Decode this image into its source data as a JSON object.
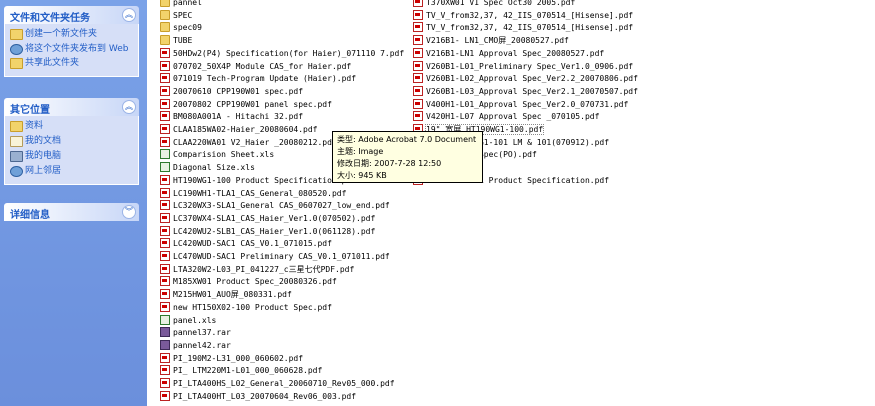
{
  "taskpane": {
    "tasks_title": "文件和文件夹任务",
    "tasks": [
      "创建一个新文件夹",
      "将这个文件夹发布到 Web",
      "共享此文件夹"
    ],
    "places_title": "其它位置",
    "places": [
      "资料",
      "我的文档",
      "我的电脑",
      "网上邻居"
    ],
    "details_title": "详细信息"
  },
  "col1": [
    {
      "name": "pannel",
      "type": "folder"
    },
    {
      "name": "SPEC",
      "type": "folder"
    },
    {
      "name": "spec09",
      "type": "folder"
    },
    {
      "name": "TUBE",
      "type": "folder"
    },
    {
      "name": "50HDw2(P4) Specification(for Haier)_071110 7.pdf",
      "type": "pdf"
    },
    {
      "name": "070702_50X4P Module CAS_for Haier.pdf",
      "type": "pdf"
    },
    {
      "name": "071019 Tech-Program Update (Haier).pdf",
      "type": "pdf"
    },
    {
      "name": "20070610 CPP190W01 spec.pdf",
      "type": "pdf"
    },
    {
      "name": "20070802 CPP190W01 panel spec.pdf",
      "type": "pdf"
    },
    {
      "name": "BM080A001A - Hitachi 32.pdf",
      "type": "pdf"
    },
    {
      "name": "CLAA185WA02-Haier_20080604.pdf",
      "type": "pdf"
    },
    {
      "name": "CLAA220WA01 V2_Haier _20080212.pdf",
      "type": "pdf"
    },
    {
      "name": "Comparision Sheet.xls",
      "type": "xls"
    },
    {
      "name": "Diagonal Size.xls",
      "type": "xls"
    },
    {
      "name": "HT190WG1-100 Product Specification.pdf",
      "type": "pdf"
    },
    {
      "name": "LC190WH1-TLA1_CAS_General_080520.pdf",
      "type": "pdf"
    },
    {
      "name": "LC320WX3-SLA1_General CAS_0607027_low_end.pdf",
      "type": "pdf"
    },
    {
      "name": "LC370WX4-SLA1_CAS_Haier_Ver1.0(070502).pdf",
      "type": "pdf"
    },
    {
      "name": "LC420WU2-SLB1_CAS_Haier_Ver1.0(061128).pdf",
      "type": "pdf"
    },
    {
      "name": "LC420WUD-SAC1 CAS_V0.1_071015.pdf",
      "type": "pdf"
    },
    {
      "name": "LC470WUD-SAC1 Preliminary CAS_V0.1_071011.pdf",
      "type": "pdf"
    },
    {
      "name": "LTA320W2-L03_PI_041227_c三星七代PDF.pdf",
      "type": "pdf"
    },
    {
      "name": "M185XW01 Product Spec_20080326.pdf",
      "type": "pdf"
    },
    {
      "name": "M215HW01_AUO屏_080331.pdf",
      "type": "pdf"
    },
    {
      "name": "new  HT150X02-100 Product Spec.pdf",
      "type": "pdf"
    },
    {
      "name": "panel.xls",
      "type": "xls"
    },
    {
      "name": "pannel37.rar",
      "type": "rar"
    },
    {
      "name": "pannel42.rar",
      "type": "rar"
    },
    {
      "name": "PI_190M2-L31_000_060602.pdf",
      "type": "pdf"
    },
    {
      "name": "PI_ LTM220M1-L01_000_060628.pdf",
      "type": "pdf"
    },
    {
      "name": "PI_LTA400HS_L02_General_20060710_Rev05_000.pdf",
      "type": "pdf"
    },
    {
      "name": "PI_LTA400HT_L03_20070604_Rev06_003.pdf",
      "type": "pdf"
    }
  ],
  "col2": [
    {
      "name": "T370XW01 V1 Spec Oct30 2005.pdf",
      "type": "pdf"
    },
    {
      "name": "TV_V_from32,37, 42_IIS_070514_[Hisense].pdf",
      "type": "pdf"
    },
    {
      "name": "TV_V_from32,37, 42_IIS_070514_[Hisense].pdf",
      "type": "pdf"
    },
    {
      "name": "V216B1- LN1_CMO屏_20080527.pdf",
      "type": "pdf"
    },
    {
      "name": "V216B1-LN1 Approval Spec_20080527.pdf",
      "type": "pdf"
    },
    {
      "name": "V260B1-L01_Preliminary  Spec_Ver1.0_0906.pdf",
      "type": "pdf"
    },
    {
      "name": "V260B1-L02_Approval Spec_Ver2.2_20070806.pdf",
      "type": "pdf"
    },
    {
      "name": "V260B1-L03_Approval Spec_Ver2.1_20070507.pdf",
      "type": "pdf"
    },
    {
      "name": "V400H1-L01_Approval Spec_Ver2.0_070731.pdf",
      "type": "pdf"
    },
    {
      "name": "V420H1-L07 Approval Spec _070105.pdf",
      "type": "pdf"
    },
    {
      "name": "19\" 宽屏 HT190WG1-100.pdf",
      "type": "pdf",
      "selected": true
    },
    {
      "name": "ween HT190WG1-101 LM & 101(070912).pdf",
      "type": "pdf"
    },
    {
      "name": "re-Product Spec(PO).pdf",
      "type": "pdf"
    },
    {
      "name": "070108.pdf",
      "type": "pdf"
    },
    {
      "name": "HT190WG1-101 Product Specification.pdf",
      "type": "pdf"
    }
  ],
  "tooltip": {
    "type": "类型: Adobe Acrobat 7.0 Document",
    "subject": "主题: Image",
    "modified": "修改日期: 2007-7-28 12:50",
    "size": "大小: 945 KB"
  }
}
